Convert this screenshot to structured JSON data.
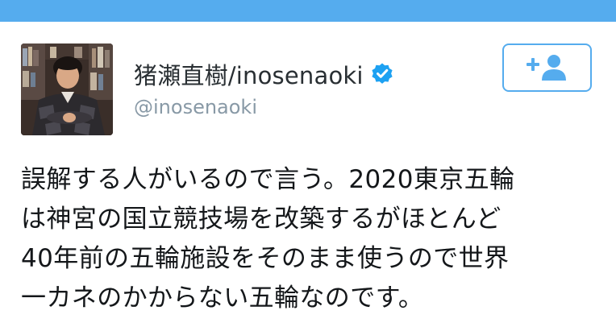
{
  "header": {
    "bar_color": "#55acee"
  },
  "tweet": {
    "author": {
      "display_name": "猪瀬直樹/inosenaoki",
      "handle": "@inosenaoki",
      "verified": true,
      "avatar_icon": "avatar-photo"
    },
    "follow_button": {
      "icon": "add-user-icon",
      "accent_color": "#55acee"
    },
    "text_lines": [
      "誤解する人がいるので言う。2020東京五輪",
      "は神宮の国立競技場を改築するがほとんど",
      "40年前の五輪施設をそのまま使うので世界",
      "一カネのかからない五輪なのです。"
    ]
  },
  "colors": {
    "name": "#292f33",
    "handle": "#8899a6",
    "body_text": "#14171a",
    "verified_badge": "#1da1f2"
  }
}
